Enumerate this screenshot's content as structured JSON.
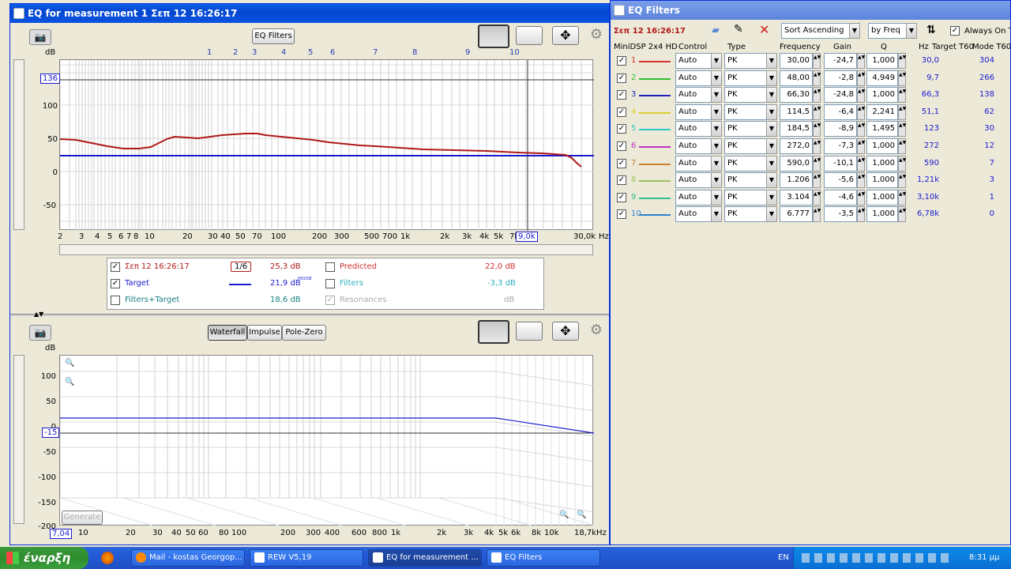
{
  "eq_window": {
    "title": "EQ for measurement 1 Σεπ 12 16:26:17",
    "eq_filters_button": "EQ Filters",
    "top_chart": {
      "y_unit": "dB",
      "y_ticks": [
        "100",
        "50",
        "0",
        "-50"
      ],
      "y_marker": "136",
      "x_ticks": [
        "2",
        "3",
        "4",
        "5",
        "6",
        "7",
        "8",
        "10",
        "20",
        "30",
        "40",
        "50",
        "70",
        "100",
        "200",
        "300",
        "500",
        "700",
        "1k",
        "2k",
        "3k",
        "4k",
        "5k",
        "7k",
        "30,0k"
      ],
      "x_marker": "9,0k",
      "x_unit": "Hz",
      "filter_markers": [
        "1",
        "2",
        "3",
        "4",
        "5",
        "6",
        "7",
        "8",
        "9",
        "10"
      ]
    },
    "legend": {
      "measurement_label": "Σεπ 12 16:26:17",
      "smoothing": "1/6",
      "measurement_value": "25,3 dB",
      "target_label": "Target",
      "target_value": "21,9 dB",
      "target_sup": "HOUSE",
      "filters_target_label": "Filters+Target",
      "filters_target_value": "18,6 dB",
      "predicted_label": "Predicted",
      "predicted_value": "22,0 dB",
      "filters_label": "Filters",
      "filters_value": "-3,3 dB",
      "resonances_label": "Resonances",
      "resonances_value": "dB"
    },
    "bottom_tabs": [
      "Waterfall",
      "Impulse",
      "Pole-Zero"
    ],
    "bottom_chart": {
      "y_unit": "dB",
      "y_ticks": [
        "100",
        "50",
        "0",
        "-50",
        "-100",
        "-150",
        "-200"
      ],
      "y_marker": "-15",
      "x_ticks": [
        "10",
        "20",
        "30",
        "40",
        "50",
        "60",
        "80",
        "100",
        "200",
        "300",
        "400",
        "600",
        "800",
        "1k",
        "2k",
        "3k",
        "4k",
        "5k",
        "6k",
        "8k",
        "10k",
        "18,7kHz"
      ],
      "x_marker": "7,04",
      "generate_button": "Generate"
    }
  },
  "eq_filters_window": {
    "title": "EQ Filters",
    "measurement": "Σεπ 12 16:26:17",
    "sort_order": "Sort Ascending",
    "sort_by": "by Freq",
    "always_on_top": "Always On Top",
    "device": "MiniDSP 2x4 HD",
    "columns": {
      "control": "Control",
      "type": "Type",
      "frequency": "Frequency",
      "gain": "Gain",
      "q": "Q",
      "hz": "Hz",
      "target_t60": "Target T60",
      "mode_t60": "Mode T60"
    },
    "filters": [
      {
        "num": "1",
        "color": "#d93030",
        "control": "Auto",
        "type": "PK",
        "freq": "30,00",
        "gain": "-24,7",
        "q": "1,000",
        "hz": "30,0",
        "t60": "304"
      },
      {
        "num": "2",
        "color": "#30c030",
        "control": "Auto",
        "type": "PK",
        "freq": "48,00",
        "gain": "-2,8",
        "q": "4,949",
        "hz": "9,7",
        "t60": "266"
      },
      {
        "num": "3",
        "color": "#2020c0",
        "control": "Auto",
        "type": "PK",
        "freq": "66,30",
        "gain": "-24,8",
        "q": "1,000",
        "hz": "66,3",
        "t60": "138"
      },
      {
        "num": "4",
        "color": "#d8d030",
        "control": "Auto",
        "type": "PK",
        "freq": "114,5",
        "gain": "-6,4",
        "q": "2,241",
        "hz": "51,1",
        "t60": "62"
      },
      {
        "num": "5",
        "color": "#30c8c8",
        "control": "Auto",
        "type": "PK",
        "freq": "184,5",
        "gain": "-8,9",
        "q": "1,495",
        "hz": "123",
        "t60": "30"
      },
      {
        "num": "6",
        "color": "#c030c0",
        "control": "Auto",
        "type": "PK",
        "freq": "272,0",
        "gain": "-7,3",
        "q": "1,000",
        "hz": "272",
        "t60": "12"
      },
      {
        "num": "7",
        "color": "#c88030",
        "control": "Auto",
        "type": "PK",
        "freq": "590,0",
        "gain": "-10,1",
        "q": "1,000",
        "hz": "590",
        "t60": "7"
      },
      {
        "num": "8",
        "color": "#a0c060",
        "control": "Auto",
        "type": "PK",
        "freq": "1.206",
        "gain": "-5,6",
        "q": "1,000",
        "hz": "1,21k",
        "t60": "3"
      },
      {
        "num": "9",
        "color": "#30c090",
        "control": "Auto",
        "type": "PK",
        "freq": "3.104",
        "gain": "-4,6",
        "q": "1,000",
        "hz": "3,10k",
        "t60": "1"
      },
      {
        "num": "10",
        "color": "#3080d0",
        "control": "Auto",
        "type": "PK",
        "freq": "6.777",
        "gain": "-3,5",
        "q": "1,000",
        "hz": "6,78k",
        "t60": "0"
      }
    ]
  },
  "taskbar": {
    "start": "έναρξη",
    "tasks": [
      "Mail - kostas Georgop...",
      "REW V5,19",
      "EQ for measurement ...",
      "EQ Filters"
    ],
    "lang": "EN",
    "clock": "8:31 μμ"
  }
}
